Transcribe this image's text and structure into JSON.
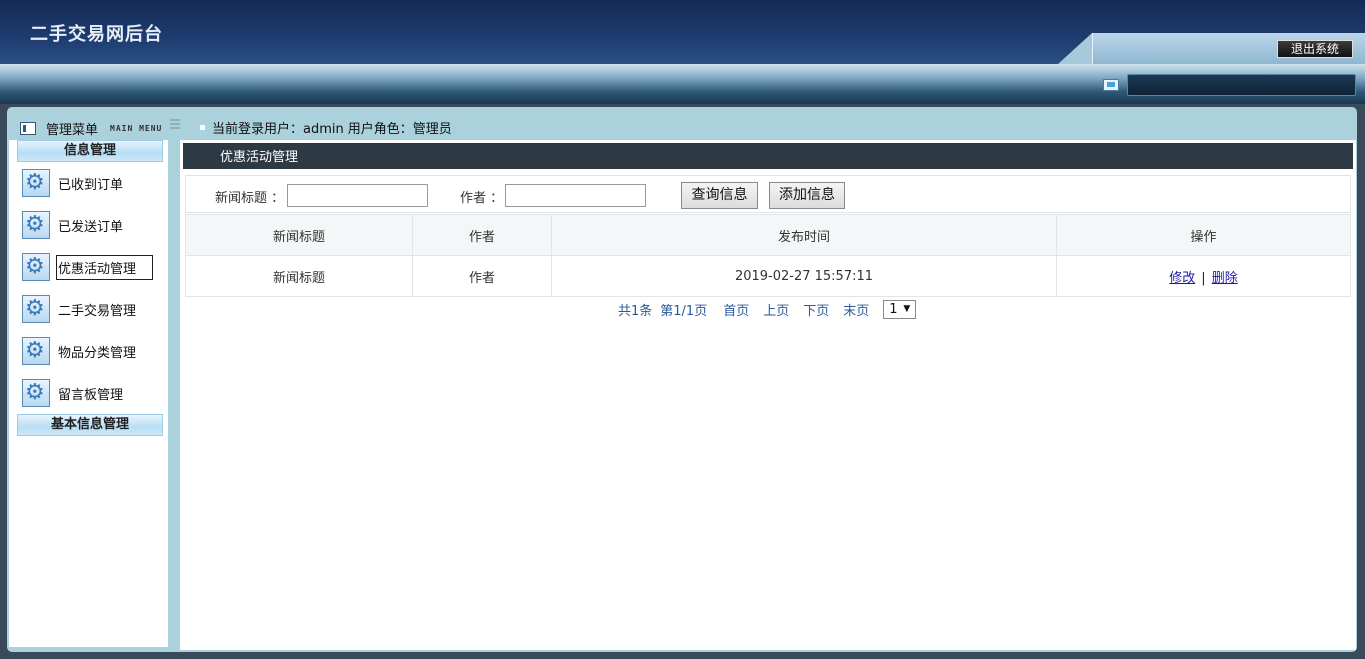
{
  "header": {
    "title": "二手交易网后台",
    "logout_label": "退出系统"
  },
  "menu": {
    "title": "管理菜单",
    "subtitle": "MAIN MENU"
  },
  "user": {
    "login_label": "当前登录用户：admin",
    "role_label": "用户角色：管理员"
  },
  "sidebar": {
    "groups": [
      {
        "label": "信息管理",
        "items": [
          {
            "label": "已收到订单",
            "icon": "gear-icon"
          },
          {
            "label": "已发送订单",
            "icon": "gear-icon"
          },
          {
            "label": "优惠活动管理",
            "icon": "gear-icon",
            "active": true
          },
          {
            "label": "二手交易管理",
            "icon": "gear-icon"
          },
          {
            "label": "物品分类管理",
            "icon": "gear-icon"
          },
          {
            "label": "留言板管理",
            "icon": "gear-icon"
          }
        ]
      },
      {
        "label": "基本信息管理"
      }
    ]
  },
  "content": {
    "title": "优惠活动管理",
    "search": {
      "title_label": "新闻标题 ：",
      "title_value": "",
      "author_label": "作者 ：",
      "author_value": "",
      "query_button": "查询信息",
      "add_button": "添加信息"
    },
    "table": {
      "columns": [
        "新闻标题",
        "作者",
        "发布时间",
        "操作"
      ],
      "rows": [
        {
          "title": "新闻标题",
          "author": "作者",
          "time": "2019-02-27 15:57:11",
          "edit": "修改",
          "sep": "|",
          "delete": "删除"
        }
      ]
    },
    "pager": {
      "total": "共1条",
      "page_info": "第1/1页",
      "first": "首页",
      "prev": "上页",
      "next": "下页",
      "last": "末页",
      "current": "1"
    }
  }
}
